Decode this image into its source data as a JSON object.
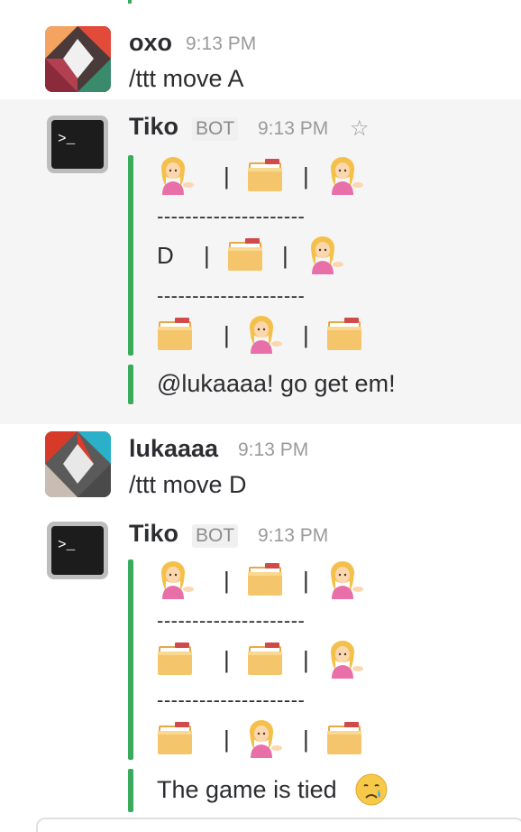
{
  "messages": [
    {
      "author": "oxo",
      "time": "9:13 PM",
      "text": "/ttt move A"
    },
    {
      "author": "Tiko",
      "badge": "BOT",
      "time": "9:13 PM",
      "board": {
        "rows": [
          [
            "person",
            "folder",
            "person"
          ],
          [
            "D",
            "folder",
            "person"
          ],
          [
            "folder",
            "person",
            "folder"
          ]
        ],
        "separator": "---------------------"
      },
      "note": "@lukaaaa! go get em!"
    },
    {
      "author": "lukaaaa",
      "time": "9:13 PM",
      "text": "/ttt move D"
    },
    {
      "author": "Tiko",
      "badge": "BOT",
      "time": "9:13 PM",
      "board": {
        "rows": [
          [
            "person",
            "folder",
            "person"
          ],
          [
            "folder",
            "folder",
            "person"
          ],
          [
            "folder",
            "person",
            "folder"
          ]
        ],
        "separator": "---------------------"
      },
      "note": "The game is tied"
    }
  ],
  "pipe": "|",
  "icons": {
    "star": "star-icon",
    "terminal": "terminal-icon",
    "person": "person-tipping-hand-icon",
    "folder": "file-folder-icon",
    "cry": "crying-face-icon"
  },
  "colors": {
    "accent": "#3aaa5c",
    "highlight": "#f5f5f5"
  }
}
